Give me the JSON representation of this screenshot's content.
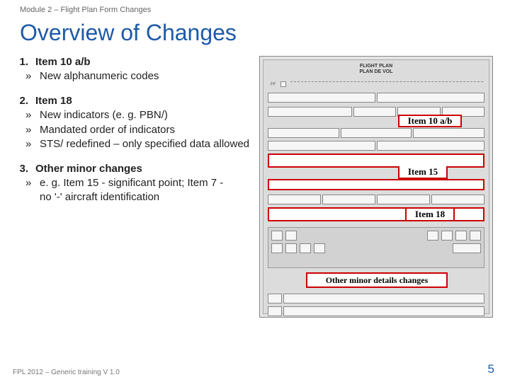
{
  "module": "Module 2 – Flight Plan Form Changes",
  "title": "Overview of Changes",
  "items": [
    {
      "num": "1.",
      "head": "Item 10 a/b",
      "subs": [
        "New alphanumeric codes"
      ]
    },
    {
      "num": "2.",
      "head": "Item 18",
      "subs": [
        "New indicators (e. g. PBN/)",
        "Mandated order of indicators",
        "STS/ redefined – only specified data allowed"
      ]
    },
    {
      "num": "3.",
      "head": "Other minor changes",
      "subs": [
        "e. g. Item 15 - significant point; Item 7 - no '-' aircraft identification"
      ],
      "wrap": true
    }
  ],
  "form": {
    "title_top": "FLIGHT PLAN",
    "title_bot": "PLAN DE VOL",
    "ff": "FF",
    "labels": {
      "item10": "Item 10 a/b",
      "item15": "Item 15",
      "item18": "Item 18",
      "other": "Other minor details changes"
    }
  },
  "footer": "FPL 2012 – Generic training V 1.0",
  "page": "5"
}
